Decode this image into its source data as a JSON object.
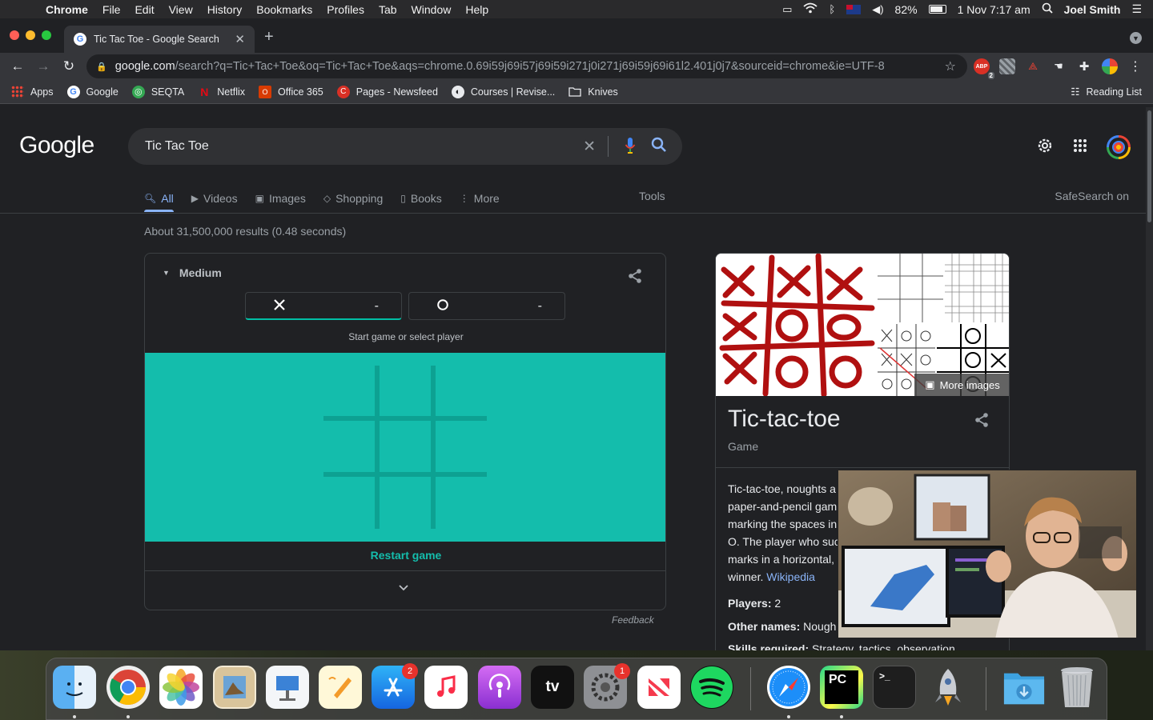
{
  "menubar": {
    "app": "Chrome",
    "menus": [
      "File",
      "Edit",
      "View",
      "History",
      "Bookmarks",
      "Profiles",
      "Tab",
      "Window",
      "Help"
    ],
    "battery": "82%",
    "datetime": "1 Nov  7:17 am",
    "user": "Joel Smith"
  },
  "browser": {
    "tab_title": "Tic Tac Toe - Google Search",
    "url_host": "google.com",
    "url_rest": "/search?q=Tic+Tac+Toe&oq=Tic+Tac+Toe&aqs=chrome.0.69i59j69i57j69i59i271j0i271j69i59j69i61l2.401j0j7&sourceid=chrome&ie=UTF-8",
    "ext_badge": "2",
    "bookmarks": [
      "Apps",
      "Google",
      "SEQTA",
      "Netflix",
      "Office 365",
      "Pages - Newsfeed",
      "Courses | Revise...",
      "Knives"
    ],
    "reading_list": "Reading List"
  },
  "search": {
    "logo": "Google",
    "query": "Tic Tac Toe",
    "tabs": [
      "All",
      "Videos",
      "Images",
      "Shopping",
      "Books",
      "More"
    ],
    "tools": "Tools",
    "safesearch": "SafeSearch on",
    "stats": "About 31,500,000 results (0.48 seconds)"
  },
  "game": {
    "difficulty": "Medium",
    "player_x": "X",
    "player_o": "O",
    "score_x": "-",
    "score_o": "-",
    "message": "Start game or select player",
    "restart": "Restart game",
    "feedback": "Feedback",
    "board_color": "#14bdac"
  },
  "knowledge": {
    "more_images": "More images",
    "title": "Tic-tac-toe",
    "subtitle": "Game",
    "desc_lines": [
      "Tic-tac-toe, noughts a",
      "paper-and-pencil gam",
      "marking the spaces in",
      "O. The player who suc",
      "marks in a horizontal,",
      "winner."
    ],
    "wiki": "Wikipedia",
    "players_label": "Players:",
    "players_value": "2",
    "other_label": "Other names:",
    "other_value": "Nough",
    "skills_label": "Skills required:",
    "skills_value": "Strategy, tactics, observation"
  },
  "dock": {
    "appstore_badge": "2",
    "settings_badge": "1",
    "tv_label": "tv",
    "pycharm_label": "PC"
  }
}
